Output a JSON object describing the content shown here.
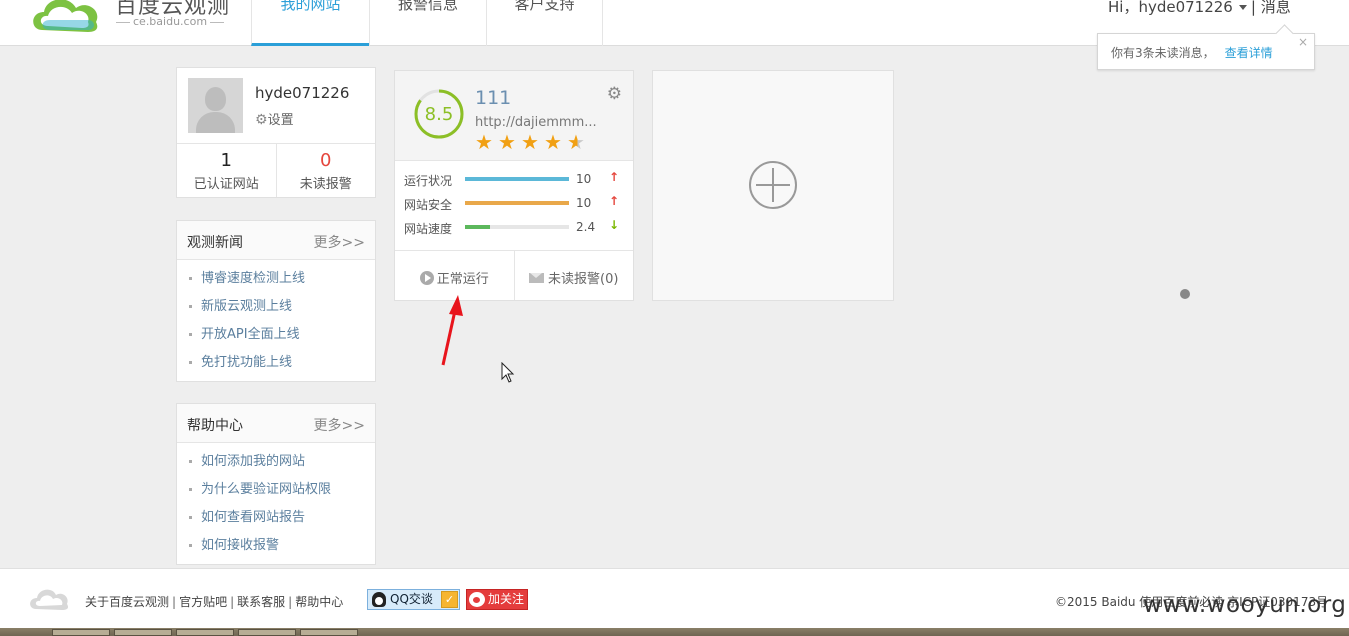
{
  "header": {
    "brand": "百度云观测",
    "brand_sub": "ce.baidu.com",
    "nav": [
      {
        "label": "我的网站",
        "active": true
      },
      {
        "label": "报警信息",
        "active": false
      },
      {
        "label": "客户支持",
        "active": false
      }
    ],
    "greeting": "Hi，hyde071226",
    "messages_label": "消息",
    "separator": "|"
  },
  "notice": {
    "text": "你有3条未读消息，",
    "link": "查看详情",
    "close": "×"
  },
  "profile": {
    "username": "hyde071226",
    "settings_label": "设置",
    "stats": [
      {
        "value": "1",
        "label": "已认证网站"
      },
      {
        "value": "0",
        "label": "未读报警"
      }
    ]
  },
  "news": {
    "title": "观测新闻",
    "more": "更多>>",
    "items": [
      "博睿速度检测上线",
      "新版云观测上线",
      "开放API全面上线",
      "免打扰功能上线"
    ]
  },
  "help": {
    "title": "帮助中心",
    "more": "更多>>",
    "items": [
      "如何添加我的网站",
      "为什么要验证网站权限",
      "如何查看网站报告",
      "如何接收报警"
    ]
  },
  "site_card": {
    "score": "8.5",
    "score_fraction": 0.85,
    "name": "111",
    "url": "http://dajiemmm...",
    "rating": 4.5,
    "stars": [
      "★",
      "★",
      "★",
      "★",
      "★"
    ],
    "metrics": [
      {
        "label": "运行状况",
        "value": "10",
        "level": 1.0,
        "color": "#5bb8d8",
        "trend": "↑",
        "trend_dir": "up"
      },
      {
        "label": "网站安全",
        "value": "10",
        "level": 1.0,
        "color": "#e9a84a",
        "trend": "↑",
        "trend_dir": "up"
      },
      {
        "label": "网站速度",
        "value": "2.4",
        "level": 0.24,
        "color": "#5cb85c",
        "trend": "↓",
        "trend_dir": "down"
      }
    ],
    "status_label": "正常运行",
    "alerts_label": "未读报警(0)"
  },
  "footer": {
    "links": [
      "关于百度云观测",
      "官方贴吧",
      "联系客服",
      "帮助中心"
    ],
    "link_separator": "|",
    "qq_label": "QQ交谈",
    "weibo_label": "加关注",
    "copyright": "©2015 Baidu 使用百度前必读 京ICP证030173号"
  },
  "watermark": "www.wooyun.org",
  "colors": {
    "accent": "#2b9fd8",
    "score_green": "#8cbf26",
    "alert_red": "#e5463d",
    "star": "#f1a013"
  }
}
